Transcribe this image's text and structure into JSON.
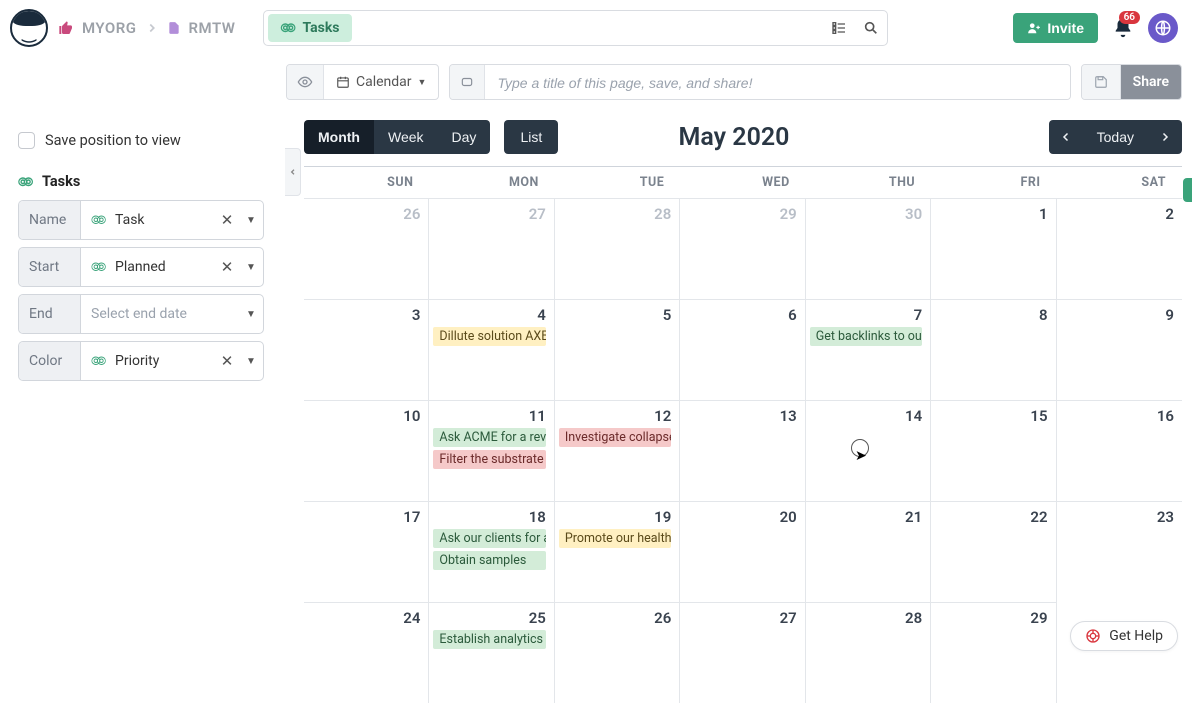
{
  "breadcrumb": {
    "org": "MYORG",
    "project": "RMTW"
  },
  "search_pill": "Tasks",
  "invite_label": "Invite",
  "bell_count": "66",
  "toolbar": {
    "calendar_label": "Calendar",
    "title_placeholder": "Type a title of this page, save, and share!",
    "share_label": "Share"
  },
  "views": {
    "month": "Month",
    "week": "Week",
    "day": "Day",
    "list": "List"
  },
  "cal_title": "May 2020",
  "today_label": "Today",
  "sidebar": {
    "save_position": "Save position to view",
    "section_title": "Tasks",
    "fields": {
      "name_label": "Name",
      "name_value": "Task",
      "start_label": "Start",
      "start_value": "Planned",
      "end_label": "End",
      "end_placeholder": "Select end date",
      "color_label": "Color",
      "color_value": "Priority"
    }
  },
  "week_headers": [
    "SUN",
    "MON",
    "TUE",
    "WED",
    "THU",
    "FRI",
    "SAT"
  ],
  "days": [
    {
      "n": "26",
      "other": true,
      "events": []
    },
    {
      "n": "27",
      "other": true,
      "events": []
    },
    {
      "n": "28",
      "other": true,
      "events": []
    },
    {
      "n": "29",
      "other": true,
      "events": []
    },
    {
      "n": "30",
      "other": true,
      "events": []
    },
    {
      "n": "1",
      "events": []
    },
    {
      "n": "2",
      "events": []
    },
    {
      "n": "3",
      "events": []
    },
    {
      "n": "4",
      "events": [
        {
          "c": "yellow",
          "t": "Dillute solution AXB-"
        }
      ]
    },
    {
      "n": "5",
      "events": []
    },
    {
      "n": "6",
      "events": []
    },
    {
      "n": "7",
      "events": [
        {
          "c": "green",
          "t": "Get backlinks to our"
        }
      ]
    },
    {
      "n": "8",
      "events": []
    },
    {
      "n": "9",
      "events": []
    },
    {
      "n": "10",
      "events": []
    },
    {
      "n": "11",
      "events": [
        {
          "c": "green",
          "t": "Ask ACME for a revie"
        },
        {
          "c": "red",
          "t": "Filter the substrate"
        }
      ]
    },
    {
      "n": "12",
      "events": [
        {
          "c": "red",
          "t": "Investigate collapsed"
        }
      ]
    },
    {
      "n": "13",
      "events": []
    },
    {
      "n": "14",
      "events": []
    },
    {
      "n": "15",
      "events": []
    },
    {
      "n": "16",
      "events": []
    },
    {
      "n": "17",
      "events": []
    },
    {
      "n": "18",
      "events": [
        {
          "c": "green",
          "t": "Ask our clients for a"
        },
        {
          "c": "green",
          "t": "Obtain samples"
        }
      ]
    },
    {
      "n": "19",
      "events": [
        {
          "c": "yellow",
          "t": "Promote our health c"
        }
      ]
    },
    {
      "n": "20",
      "events": []
    },
    {
      "n": "21",
      "events": []
    },
    {
      "n": "22",
      "events": []
    },
    {
      "n": "23",
      "events": []
    },
    {
      "n": "24",
      "events": []
    },
    {
      "n": "25",
      "events": [
        {
          "c": "green",
          "t": "Establish analytics m"
        }
      ]
    },
    {
      "n": "26",
      "events": []
    },
    {
      "n": "27",
      "events": []
    },
    {
      "n": "28",
      "events": []
    },
    {
      "n": "29",
      "events": []
    }
  ],
  "get_help": "Get Help"
}
